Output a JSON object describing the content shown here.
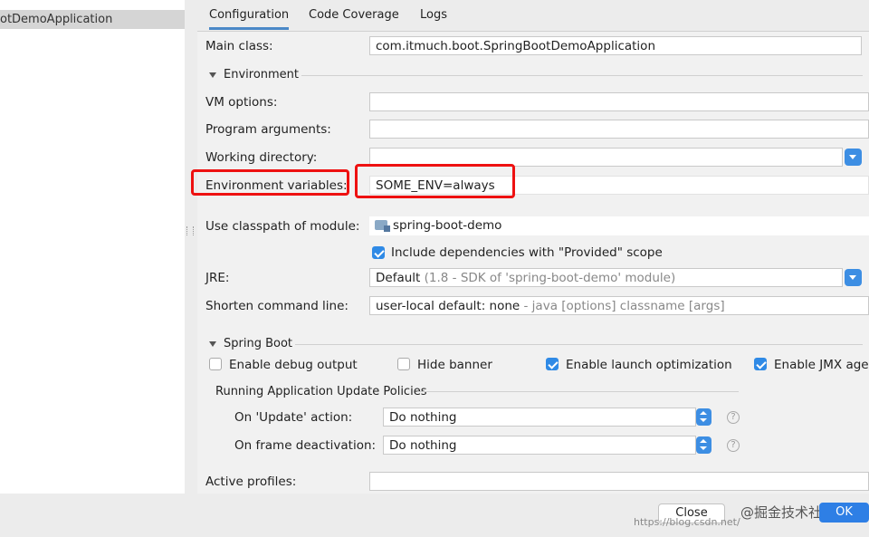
{
  "sidebar": {
    "selected_item": "otDemoApplication"
  },
  "tabs": [
    {
      "label": "Configuration"
    },
    {
      "label": "Code Coverage"
    },
    {
      "label": "Logs"
    }
  ],
  "form": {
    "main_class": {
      "label": "Main class:",
      "value": "com.itmuch.boot.SpringBootDemoApplication"
    },
    "environment_section": "Environment",
    "vm_options": {
      "label": "VM options:",
      "value": ""
    },
    "program_arguments": {
      "label": "Program arguments:",
      "value": ""
    },
    "working_directory": {
      "label": "Working directory:",
      "value": ""
    },
    "environment_variables": {
      "label": "Environment variables:",
      "value": "SOME_ENV=always"
    },
    "classpath_module": {
      "label": "Use classpath of module:",
      "value": "spring-boot-demo"
    },
    "include_provided": {
      "label": "Include dependencies with \"Provided\" scope",
      "checked": true
    },
    "jre": {
      "label": "JRE:",
      "value": "Default",
      "hint": "(1.8 - SDK of 'spring-boot-demo' module)"
    },
    "shorten_cmd": {
      "label": "Shorten command line:",
      "value": "user-local default: none",
      "hint": "- java [options] classname [args]"
    },
    "spring_boot_section": "Spring Boot",
    "enable_debug": {
      "label": "Enable debug output",
      "checked": false
    },
    "hide_banner": {
      "label": "Hide banner",
      "checked": false
    },
    "launch_opt": {
      "label": "Enable launch optimization",
      "checked": true
    },
    "enable_jmx": {
      "label": "Enable JMX age",
      "checked": true
    },
    "update_policies_section": "Running Application Update Policies",
    "on_update": {
      "label": "On 'Update' action:",
      "value": "Do nothing"
    },
    "on_frame": {
      "label": "On frame deactivation:",
      "value": "Do nothing"
    },
    "active_profiles": {
      "label": "Active profiles:",
      "value": ""
    }
  },
  "footer": {
    "close_label": "Close",
    "ok_label": "OK",
    "watermark": "@掘金技术社区",
    "watermark_url": "https://blog.csdn.net/"
  },
  "colors": {
    "accent": "#2e7fe5",
    "highlight": "#e11111"
  }
}
